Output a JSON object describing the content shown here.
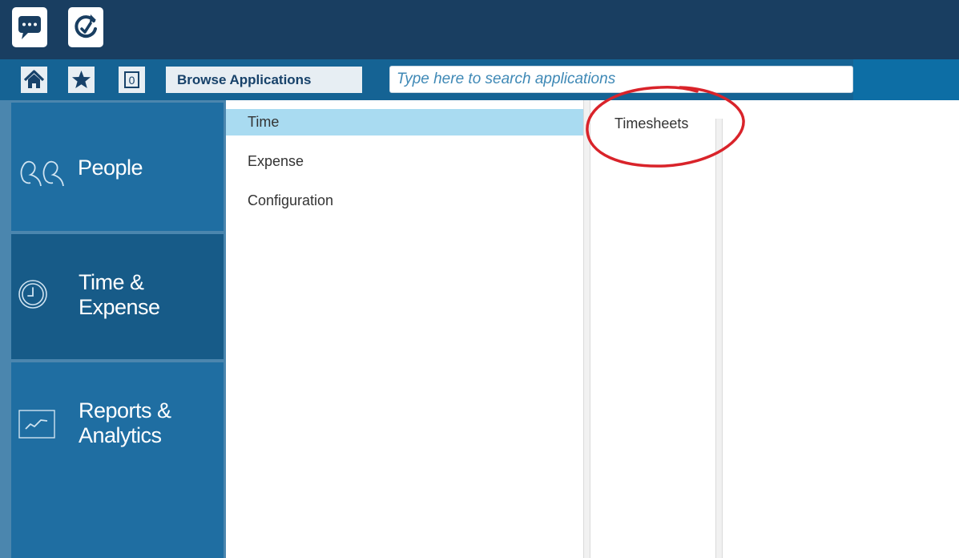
{
  "colors": {
    "topbar": "#193e61",
    "navbar": "#156394",
    "sidebar_item": "#1f6ea2",
    "sidebar_item_active": "#175b88",
    "menu_active": "#a9dbf1",
    "search_text": "#3f89b6",
    "annotation": "#d9232a"
  },
  "topbar": {
    "buttons": [
      {
        "icon": "chat-bubble-icon"
      },
      {
        "icon": "refresh-check-icon"
      }
    ]
  },
  "navbar": {
    "home_icon": "home-icon",
    "favorites_icon": "star-icon",
    "counter_icon": "counter-icon",
    "counter_value": "0",
    "browse_label": "Browse Applications",
    "search_placeholder": "Type here to search applications"
  },
  "sidebar": {
    "items": [
      {
        "label": "People",
        "icon": "people-icon"
      },
      {
        "label_line1": "Time &",
        "label_line2": "Expense",
        "icon": "clock-icon",
        "active": true
      },
      {
        "label_line1": "Reports &",
        "label_line2": "Analytics",
        "icon": "chart-icon"
      }
    ]
  },
  "submenu": {
    "items": [
      {
        "label": "Time",
        "active": true
      },
      {
        "label": "Expense"
      },
      {
        "label": "Configuration"
      }
    ]
  },
  "applications": {
    "items": [
      {
        "label": "Timesheets"
      }
    ]
  }
}
